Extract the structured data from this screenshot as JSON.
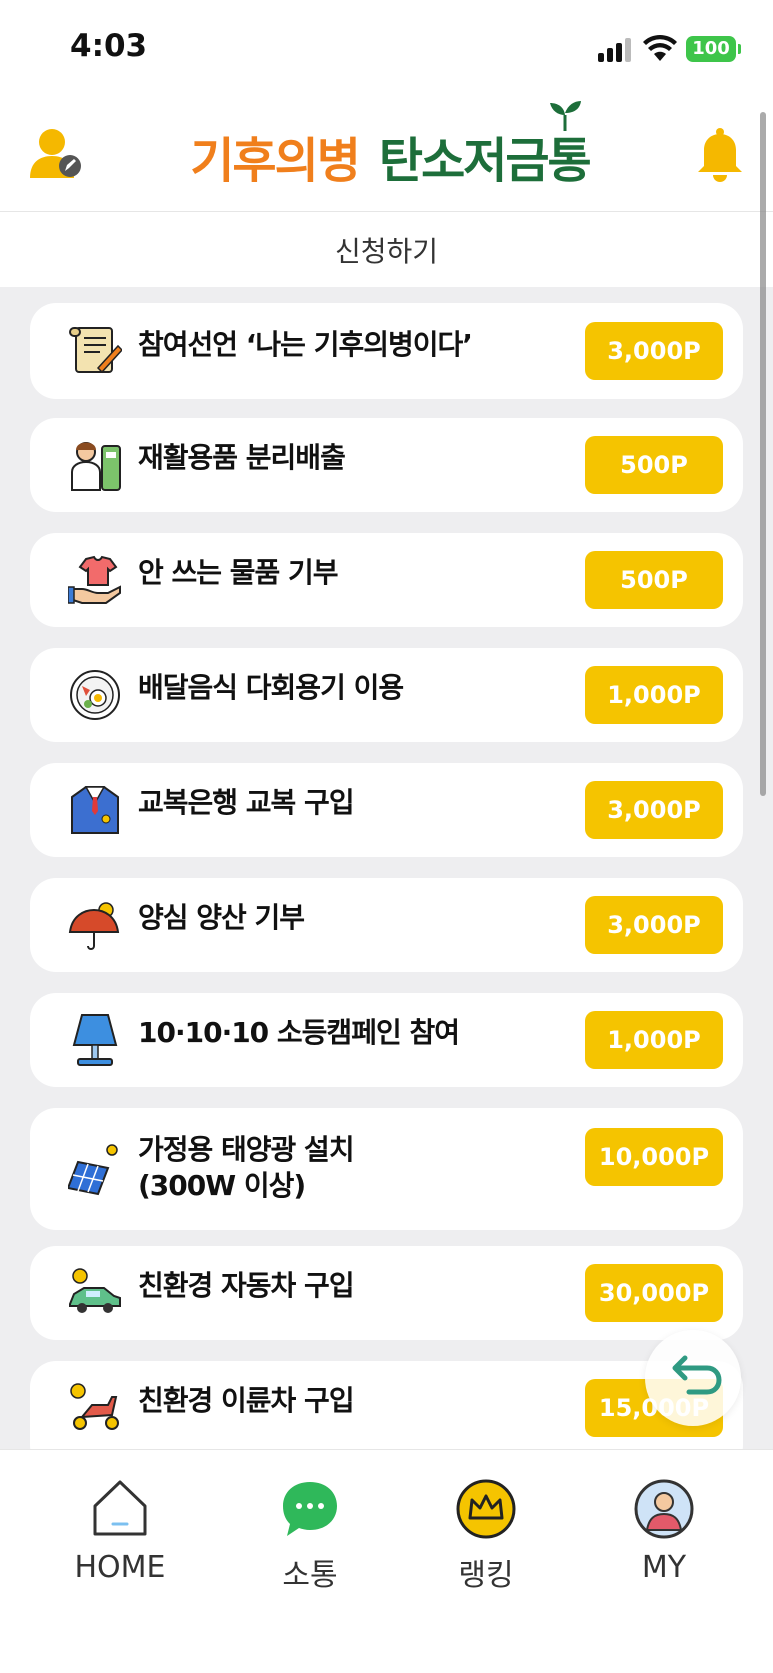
{
  "status_bar": {
    "time": "4:03",
    "battery": "100"
  },
  "header": {
    "logo_part1": "기후의병",
    "logo_part2": "탄소저금통"
  },
  "subheader": {
    "title": "신청하기"
  },
  "items": [
    {
      "label": "참여선언 ‘나는 기후의병이다’",
      "points": "3,000P",
      "icon": "manifesto-scroll-icon"
    },
    {
      "label": "재활용품 분리배출",
      "points": "500P",
      "icon": "recycling-person-icon"
    },
    {
      "label": "안 쓰는 물품 기부",
      "points": "500P",
      "icon": "donate-shirt-hand-icon"
    },
    {
      "label": "배달음식 다회용기 이용",
      "points": "1,000P",
      "icon": "food-plate-icon"
    },
    {
      "label": "교복은행 교복 구입",
      "points": "3,000P",
      "icon": "school-uniform-icon"
    },
    {
      "label": "양심 양산 기부",
      "points": "3,000P",
      "icon": "sun-umbrella-icon"
    },
    {
      "label": "10·10·10 소등캠페인 참여",
      "points": "1,000P",
      "icon": "lamp-icon"
    },
    {
      "label": "가정용 태양광 설치",
      "label2": "(300W 이상)",
      "points": "10,000P",
      "icon": "solar-panel-icon"
    },
    {
      "label": "친환경 자동차 구입",
      "points": "30,000P",
      "icon": "eco-car-icon"
    },
    {
      "label": "친환경 이륜차 구입",
      "points": "15,000P",
      "icon": "eco-scooter-icon"
    }
  ],
  "tabs": [
    {
      "label": "HOME",
      "icon": "home-icon"
    },
    {
      "label": "소통",
      "icon": "chat-bubble-icon"
    },
    {
      "label": "랭킹",
      "icon": "crown-icon"
    },
    {
      "label": "MY",
      "icon": "user-avatar-icon"
    }
  ],
  "colors": {
    "accent": "#f5c400",
    "logo_orange": "#f07f1c",
    "logo_green": "#1d6e3a",
    "list_bg": "#eeeef0"
  }
}
